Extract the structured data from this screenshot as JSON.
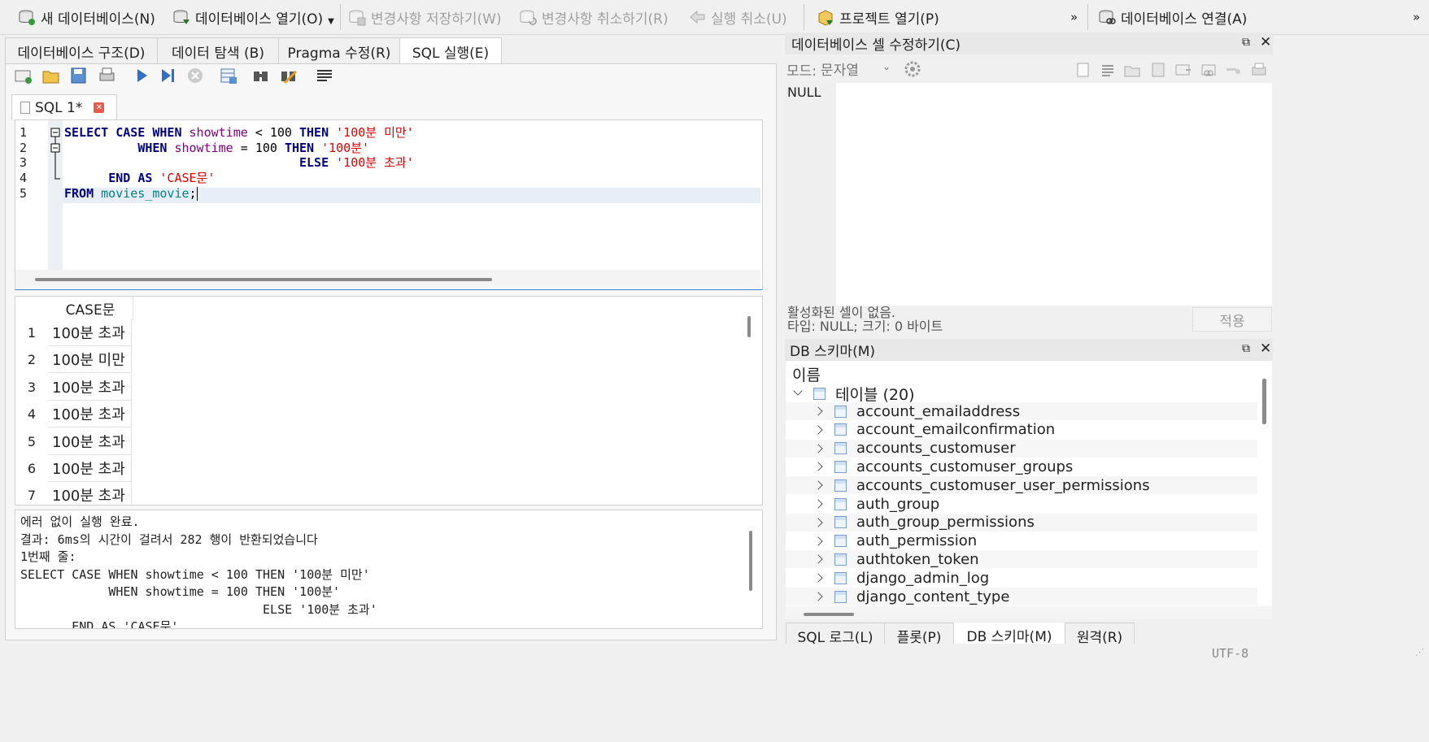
{
  "toolbar": {
    "new_db": "새 데이터베이스(N)",
    "open_db": "데이터베이스 열기(O)",
    "write_changes": "변경사항 저장하기(W)",
    "revert_changes": "변경사항 취소하기(R)",
    "undo": "실행 취소(U)",
    "open_project": "프로젝트 열기(P)",
    "overflow": "»",
    "attach_db": "데이터베이스 연결(A)"
  },
  "tabs": [
    {
      "label": "데이터베이스 구조(D)"
    },
    {
      "label": "데이터 탐색 (B)"
    },
    {
      "label": "Pragma 수정(R)"
    },
    {
      "label": "SQL 실행(E)"
    }
  ],
  "sql_tab": {
    "label": "SQL 1*"
  },
  "editor": {
    "line_numbers": [
      "1",
      "2",
      "3",
      "4",
      "5"
    ],
    "lines": [
      [
        {
          "t": "SELECT ",
          "c": "kw"
        },
        {
          "t": "CASE ",
          "c": "kw"
        },
        {
          "t": "WHEN ",
          "c": "kw"
        },
        {
          "t": "showtime",
          "c": "col"
        },
        {
          "t": " < ",
          "c": "num"
        },
        {
          "t": "100",
          "c": "num"
        },
        {
          "t": " ",
          "c": "num"
        },
        {
          "t": "THEN ",
          "c": "kw"
        },
        {
          "t": "'100분 미만'",
          "c": "str"
        }
      ],
      [
        {
          "t": "          ",
          "c": "num"
        },
        {
          "t": "WHEN ",
          "c": "kw"
        },
        {
          "t": "showtime",
          "c": "col"
        },
        {
          "t": " = ",
          "c": "num"
        },
        {
          "t": "100",
          "c": "num"
        },
        {
          "t": " ",
          "c": "num"
        },
        {
          "t": "THEN ",
          "c": "kw"
        },
        {
          "t": "'100분'",
          "c": "str"
        }
      ],
      [
        {
          "t": "                                ",
          "c": "num"
        },
        {
          "t": "ELSE ",
          "c": "kw"
        },
        {
          "t": "'100분 초과'",
          "c": "str"
        }
      ],
      [
        {
          "t": "      ",
          "c": "num"
        },
        {
          "t": "END ",
          "c": "kw"
        },
        {
          "t": "AS ",
          "c": "kw"
        },
        {
          "t": "'CASE문'",
          "c": "str"
        }
      ],
      [
        {
          "t": "FROM ",
          "c": "kw"
        },
        {
          "t": "movies_movie",
          "c": "tbl"
        },
        {
          "t": ";",
          "c": "num"
        }
      ]
    ]
  },
  "results": {
    "column_header": "CASE문",
    "rows": [
      {
        "num": "1",
        "value": "100분 초과"
      },
      {
        "num": "2",
        "value": "100분 미만"
      },
      {
        "num": "3",
        "value": "100분 초과"
      },
      {
        "num": "4",
        "value": "100분 초과"
      },
      {
        "num": "5",
        "value": "100분 초과"
      },
      {
        "num": "6",
        "value": "100분 초과"
      },
      {
        "num": "7",
        "value": "100분 초과"
      }
    ]
  },
  "message": {
    "lines": [
      "에러 없이 실행 완료.",
      "결과: 6ms의 시간이 걸려서 282 행이 반환되었습니다",
      "1번째 줄:",
      "SELECT CASE WHEN showtime < 100 THEN '100분 미만'",
      "            WHEN showtime = 100 THEN '100분'",
      "                                 ELSE '100분 초과'",
      "       END AS 'CASE문'"
    ]
  },
  "edit_cell": {
    "title": "데이터베이스 셀 수정하기(C)",
    "mode_label": "모드:",
    "mode_value": "문자열",
    "content": "NULL",
    "status_line1": "활성화된 셀이 없음.",
    "status_line2": "타입: NULL; 크기: 0 바이트",
    "apply_button": "적용"
  },
  "schema": {
    "title": "DB 스키마(M)",
    "header": "이름",
    "tables_node": "테이블 (20)",
    "tables": [
      "account_emailaddress",
      "account_emailconfirmation",
      "accounts_customuser",
      "accounts_customuser_groups",
      "accounts_customuser_user_permissions",
      "auth_group",
      "auth_group_permissions",
      "auth_permission",
      "authtoken_token",
      "django_admin_log",
      "django_content_type"
    ]
  },
  "bottom_tabs": [
    {
      "label": "SQL 로그(L)"
    },
    {
      "label": "플롯(P)"
    },
    {
      "label": "DB 스키마(M)"
    },
    {
      "label": "원격(R)"
    }
  ],
  "status_bar": {
    "encoding": "UTF-8"
  }
}
